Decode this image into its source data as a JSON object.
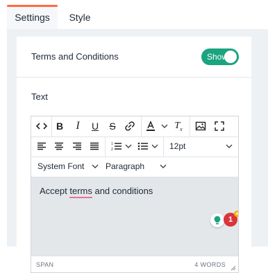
{
  "tabs": [
    {
      "label": "Settings",
      "active": true
    },
    {
      "label": "Style",
      "active": false
    }
  ],
  "terms": {
    "label": "Terms and Conditions",
    "toggle_label": "Show",
    "toggle_on": true
  },
  "text_field": {
    "label": "Text"
  },
  "toolbar": {
    "font_size": "12pt",
    "font_family": "System Font",
    "block_format": "Paragraph",
    "icons": [
      "code-icon",
      "bold-icon",
      "italic-icon",
      "underline-icon",
      "strikethrough-icon",
      "link-icon",
      "text-color-icon",
      "clear-format-icon",
      "image-icon",
      "fullscreen-icon",
      "align-left-icon",
      "align-center-icon",
      "align-right-icon",
      "align-justify-icon",
      "numbered-list-icon",
      "bullet-list-icon"
    ]
  },
  "editor": {
    "text_before": "Accept ",
    "text_underlined": "terms",
    "text_after": " and conditions",
    "notification_count": "1",
    "notification_plus": "+"
  },
  "status_bar": {
    "element_path": "SPAN",
    "word_count": "4 WORDS"
  },
  "colors": {
    "accent_tab": "#ff6a3d",
    "toggle_on": "#1aa47f",
    "editor_bg": "#e3e7ea",
    "badge": "#d9353b",
    "spellcheck_underline": "#e5739a"
  }
}
